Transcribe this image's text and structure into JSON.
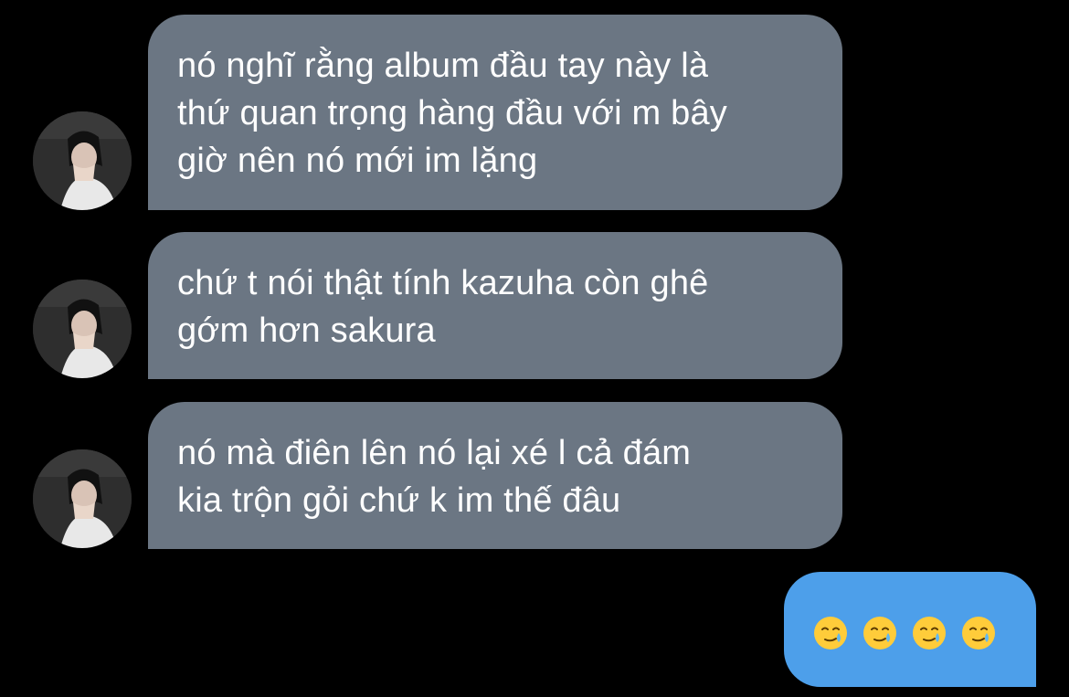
{
  "messages": [
    {
      "sender": "other",
      "text": "nó nghĩ rằng album đầu tay này là\nthứ quan trọng hàng đầu với m bây\ngiờ nên nó mới im lặng"
    },
    {
      "sender": "other",
      "text": "chứ t nói thật tính kazuha còn ghê\ngớm hơn sakura"
    },
    {
      "sender": "other",
      "text": "nó mà điên lên nó lại xé l cả đám\nkia trộn gỏi chứ k im thế đâu"
    },
    {
      "sender": "me",
      "emojis": [
        "smiling-face-with-tear-icon",
        "smiling-face-with-tear-icon",
        "smiling-face-with-tear-icon",
        "smiling-face-with-tear-icon"
      ]
    }
  ],
  "colors": {
    "background": "#000000",
    "incoming_bubble": "#6b7683",
    "outgoing_bubble": "#4d9fea",
    "text": "#ffffff"
  }
}
